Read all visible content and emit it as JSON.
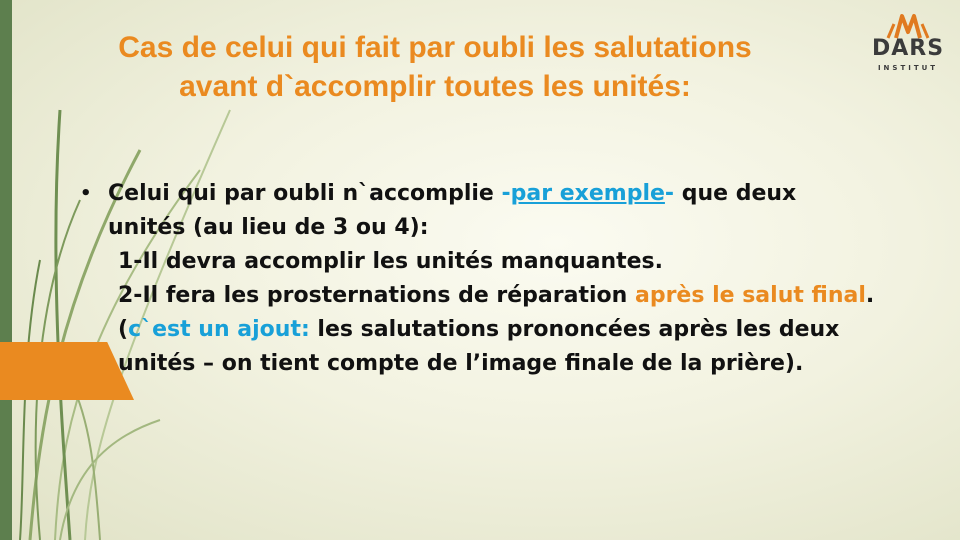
{
  "slide": {
    "title_line1": "Cas de celui qui fait par oubli les salutations",
    "title_line2": "avant d`accomplir toutes les unités:",
    "logo": {
      "name": "DARS",
      "subtitle": "INSTITUT"
    },
    "colors": {
      "accent": "#ea8a20",
      "link": "#18a0d8",
      "sidebar": "#5d7f4e"
    },
    "bullet": {
      "line1_a": "Celui qui par oubli n`accomplie ",
      "line1_dash1": "-",
      "line1_link": "par exemple",
      "line1_dash2": "-",
      "line1_b": " que deux",
      "line2": "unités (au lieu de 3 ou 4):",
      "point1": "1-Il devra accomplir les unités manquantes.",
      "point2_a": "2-Il fera les prosternations de réparation ",
      "point2_highlight": "après le salut final",
      "point2_end": ".",
      "note_open": "(",
      "note_highlight": "c`est un ajout:",
      "note_text": " les salutations prononcées après les deux",
      "note_line2": "unités – on tient compte de l’image finale de la prière)."
    }
  }
}
